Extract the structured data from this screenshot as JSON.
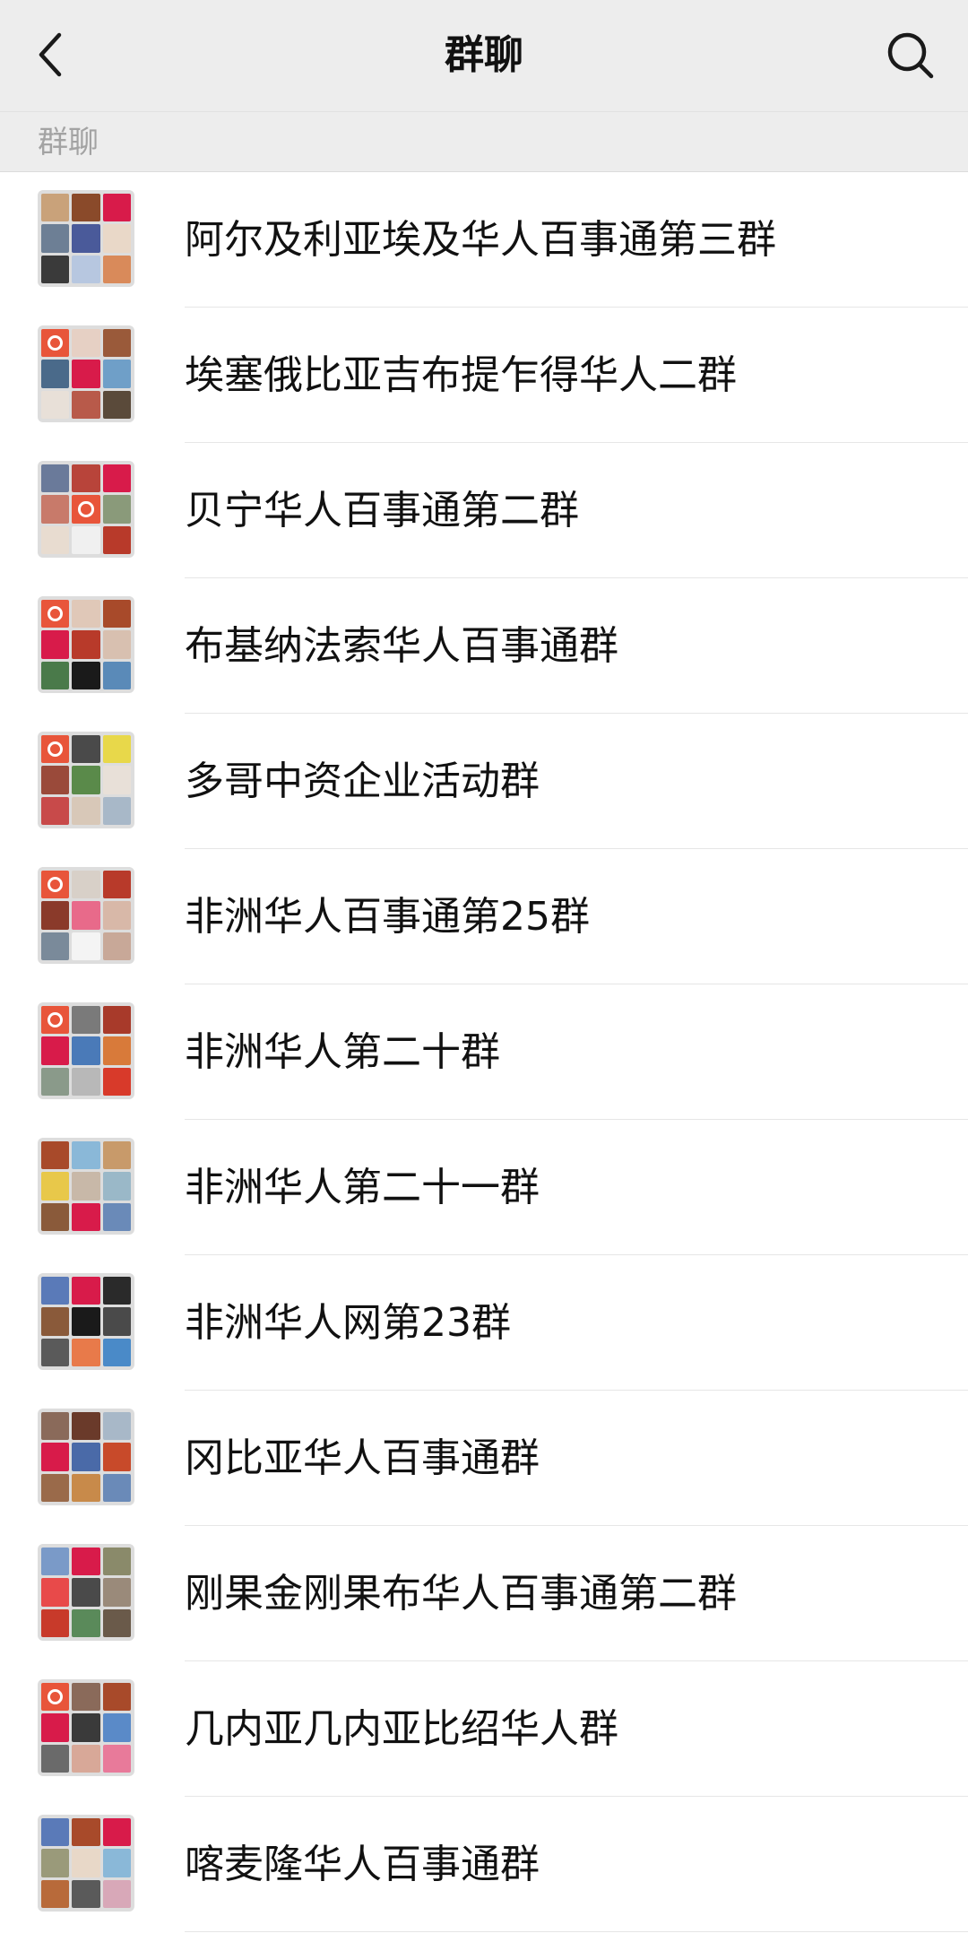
{
  "nav": {
    "title": "群聊",
    "back_icon": "chevron-left-icon",
    "search_icon": "search-icon"
  },
  "section_header": "群聊",
  "colors": {
    "nav_bg": "#ededed",
    "logo_orange": "#e8553a",
    "accent_pink": "#d81b4a"
  },
  "groups": [
    {
      "name": "阿尔及利亚埃及华人百事通第三群",
      "avatar": [
        "#c9a27a",
        "#8a4a2a",
        "#d81b4a",
        "#6d7f95",
        "#4a5a9a",
        "#e9d8c8",
        "#3a3a3a",
        "#b7c7e0",
        "#d98a5a"
      ]
    },
    {
      "name": "埃塞俄比亚吉布提乍得华人二群",
      "avatar": [
        "logo",
        "#e6d0c4",
        "#9a5a3a",
        "#4a6a8a",
        "#d81b4a",
        "#6f9fc8",
        "#e8e0d8",
        "#b85a4a",
        "#5a4a3a"
      ]
    },
    {
      "name": "贝宁华人百事通第二群",
      "avatar": [
        "#6a7a9a",
        "#b8443a",
        "#d81b4a",
        "#c87a6a",
        "logo",
        "#8a9a7a",
        "#e8dcd0",
        "#f0f0f0",
        "#b83a2a"
      ]
    },
    {
      "name": "布基纳法索华人百事通群",
      "avatar": [
        "logo",
        "#e0c8b8",
        "#a84a2a",
        "#d81b4a",
        "#b83a2a",
        "#d8c0b0",
        "#4a7a4a",
        "#1a1a1a",
        "#5a8ab8"
      ]
    },
    {
      "name": "多哥中资企业活动群",
      "avatar": [
        "logo",
        "#4a4a4a",
        "#e8d84a",
        "#9a4a3a",
        "#5a8a4a",
        "#e8e0d8",
        "#c84a4a",
        "#d8c8b8",
        "#a8b8c8"
      ]
    },
    {
      "name": "非洲华人百事通第25群",
      "avatar": [
        "logo",
        "#d8d0c8",
        "#b83a2a",
        "#8a3a2a",
        "#e86a8a",
        "#d8b8a8",
        "#7a8a9a",
        "#f4f4f4",
        "#c8a898"
      ]
    },
    {
      "name": "非洲华人第二十群",
      "avatar": [
        "logo",
        "#7a7a7a",
        "#a83a2a",
        "#d81b4a",
        "#4a7ab8",
        "#d87a3a",
        "#8a9a8a",
        "#b8b8b8",
        "#d83a2a"
      ]
    },
    {
      "name": "非洲华人第二十一群",
      "avatar": [
        "#a84a2a",
        "#8ab8d8",
        "#c89a6a",
        "#e8c84a",
        "#c8b8a8",
        "#9ab8c8",
        "#8a5a3a",
        "#d81b4a",
        "#6a8ab8"
      ]
    },
    {
      "name": "非洲华人网第23群",
      "avatar": [
        "#5a7ab8",
        "#d81b4a",
        "#2a2a2a",
        "#8a5a3a",
        "#1a1a1a",
        "#4a4a4a",
        "#5a5a5a",
        "#e87a4a",
        "#4a8ac8"
      ]
    },
    {
      "name": "冈比亚华人百事通群",
      "avatar": [
        "#8a6a5a",
        "#6a3a2a",
        "#a8b8c8",
        "#d81b4a",
        "#4a6aa8",
        "#c84a2a",
        "#9a6a4a",
        "#c88a4a",
        "#6a8ab8"
      ]
    },
    {
      "name": "刚果金刚果布华人百事通第二群",
      "avatar": [
        "#7a9ac8",
        "#d81b4a",
        "#8a8a6a",
        "#e84a4a",
        "#4a4a4a",
        "#9a8a7a",
        "#c83a2a",
        "#5a8a5a",
        "#6a5a4a"
      ]
    },
    {
      "name": "几内亚几内亚比绍华人群",
      "avatar": [
        "logo",
        "#8a6a5a",
        "#a84a2a",
        "#d81b4a",
        "#3a3a3a",
        "#5a8ac8",
        "#6a6a6a",
        "#d8a898",
        "#e87a9a"
      ]
    },
    {
      "name": "喀麦隆华人百事通群",
      "avatar": [
        "#5a7ab8",
        "#a84a2a",
        "#d81b4a",
        "#9a9a7a",
        "#e8d8c8",
        "#8ab8d8",
        "#b86a3a",
        "#5a5a5a",
        "#d8a8b8"
      ]
    }
  ]
}
